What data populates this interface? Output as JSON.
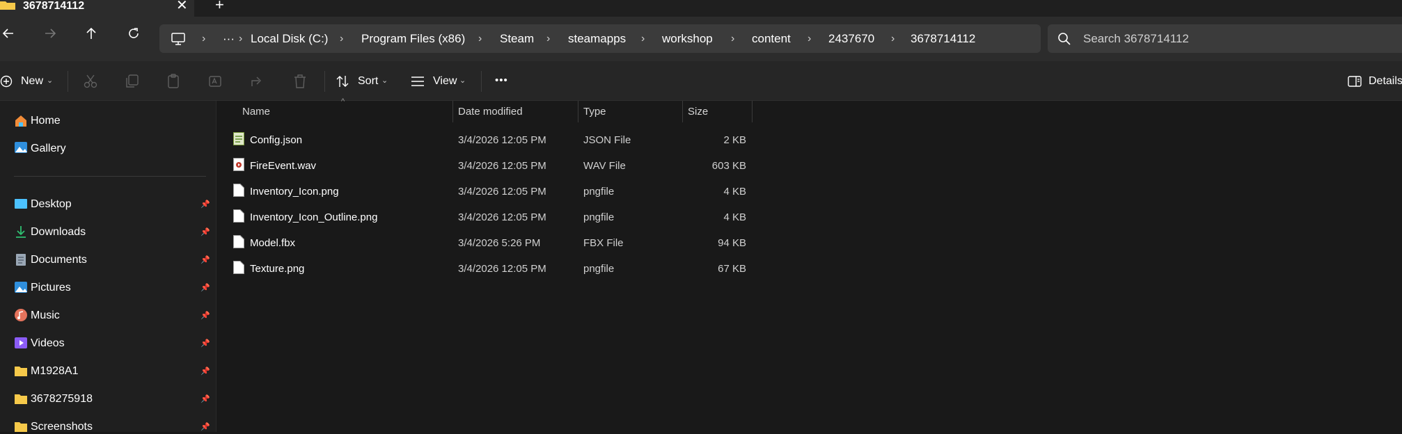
{
  "tab": {
    "title": "3678714112",
    "close": "✕",
    "new": "+"
  },
  "breadcrumb": [
    "Local Disk (C:)",
    "Program Files (x86)",
    "Steam",
    "steamapps",
    "workshop",
    "content",
    "2437670",
    "3678714112"
  ],
  "breadcrumb_overflow": "···",
  "search": {
    "placeholder": "Search 3678714112"
  },
  "toolbar": {
    "new": "New",
    "sort": "Sort",
    "view": "View",
    "more": "•••",
    "details": "Details"
  },
  "sidebar": {
    "top": [
      {
        "label": "Home",
        "icon": "home-icon"
      },
      {
        "label": "Gallery",
        "icon": "gallery-icon"
      }
    ],
    "pinned": [
      {
        "label": "Desktop",
        "icon": "desktop-icon"
      },
      {
        "label": "Downloads",
        "icon": "download-icon"
      },
      {
        "label": "Documents",
        "icon": "documents-icon"
      },
      {
        "label": "Pictures",
        "icon": "pictures-icon"
      },
      {
        "label": "Music",
        "icon": "music-icon"
      },
      {
        "label": "Videos",
        "icon": "videos-icon"
      },
      {
        "label": "M1928A1",
        "icon": "folder-icon"
      },
      {
        "label": "3678275918",
        "icon": "folder-icon"
      },
      {
        "label": "Screenshots",
        "icon": "folder-icon"
      }
    ]
  },
  "columns": {
    "name": "Name",
    "date": "Date modified",
    "type": "Type",
    "size": "Size"
  },
  "files": [
    {
      "name": "Config.json",
      "date": "3/4/2026 12:05 PM",
      "type": "JSON File",
      "size": "2 KB",
      "icon": "json-file-icon"
    },
    {
      "name": "FireEvent.wav",
      "date": "3/4/2026 12:05 PM",
      "type": "WAV File",
      "size": "603 KB",
      "icon": "audio-file-icon"
    },
    {
      "name": "Inventory_Icon.png",
      "date": "3/4/2026 12:05 PM",
      "type": "pngfile",
      "size": "4 KB",
      "icon": "file-icon"
    },
    {
      "name": "Inventory_Icon_Outline.png",
      "date": "3/4/2026 12:05 PM",
      "type": "pngfile",
      "size": "4 KB",
      "icon": "file-icon"
    },
    {
      "name": "Model.fbx",
      "date": "3/4/2026 5:26 PM",
      "type": "FBX File",
      "size": "94 KB",
      "icon": "file-icon"
    },
    {
      "name": "Texture.png",
      "date": "3/4/2026 12:05 PM",
      "type": "pngfile",
      "size": "67 KB",
      "icon": "file-icon"
    }
  ],
  "colors": {
    "accent": "#4cc2ff",
    "folder": "#f6c94a",
    "background": "#191919"
  }
}
